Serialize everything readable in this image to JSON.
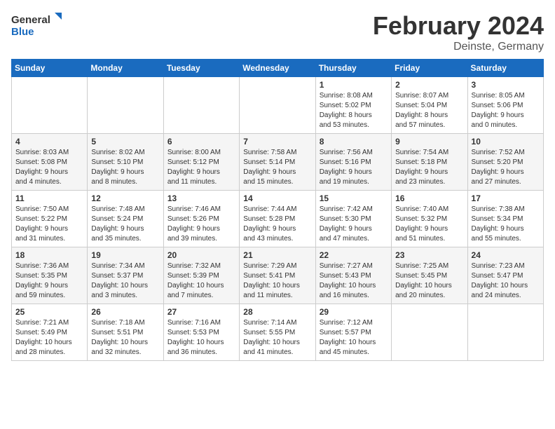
{
  "logo": {
    "general": "General",
    "blue": "Blue"
  },
  "title": "February 2024",
  "subtitle": "Deinste, Germany",
  "days_of_week": [
    "Sunday",
    "Monday",
    "Tuesday",
    "Wednesday",
    "Thursday",
    "Friday",
    "Saturday"
  ],
  "weeks": [
    [
      {
        "day": "",
        "info": ""
      },
      {
        "day": "",
        "info": ""
      },
      {
        "day": "",
        "info": ""
      },
      {
        "day": "",
        "info": ""
      },
      {
        "day": "1",
        "info": "Sunrise: 8:08 AM\nSunset: 5:02 PM\nDaylight: 8 hours\nand 53 minutes."
      },
      {
        "day": "2",
        "info": "Sunrise: 8:07 AM\nSunset: 5:04 PM\nDaylight: 8 hours\nand 57 minutes."
      },
      {
        "day": "3",
        "info": "Sunrise: 8:05 AM\nSunset: 5:06 PM\nDaylight: 9 hours\nand 0 minutes."
      }
    ],
    [
      {
        "day": "4",
        "info": "Sunrise: 8:03 AM\nSunset: 5:08 PM\nDaylight: 9 hours\nand 4 minutes."
      },
      {
        "day": "5",
        "info": "Sunrise: 8:02 AM\nSunset: 5:10 PM\nDaylight: 9 hours\nand 8 minutes."
      },
      {
        "day": "6",
        "info": "Sunrise: 8:00 AM\nSunset: 5:12 PM\nDaylight: 9 hours\nand 11 minutes."
      },
      {
        "day": "7",
        "info": "Sunrise: 7:58 AM\nSunset: 5:14 PM\nDaylight: 9 hours\nand 15 minutes."
      },
      {
        "day": "8",
        "info": "Sunrise: 7:56 AM\nSunset: 5:16 PM\nDaylight: 9 hours\nand 19 minutes."
      },
      {
        "day": "9",
        "info": "Sunrise: 7:54 AM\nSunset: 5:18 PM\nDaylight: 9 hours\nand 23 minutes."
      },
      {
        "day": "10",
        "info": "Sunrise: 7:52 AM\nSunset: 5:20 PM\nDaylight: 9 hours\nand 27 minutes."
      }
    ],
    [
      {
        "day": "11",
        "info": "Sunrise: 7:50 AM\nSunset: 5:22 PM\nDaylight: 9 hours\nand 31 minutes."
      },
      {
        "day": "12",
        "info": "Sunrise: 7:48 AM\nSunset: 5:24 PM\nDaylight: 9 hours\nand 35 minutes."
      },
      {
        "day": "13",
        "info": "Sunrise: 7:46 AM\nSunset: 5:26 PM\nDaylight: 9 hours\nand 39 minutes."
      },
      {
        "day": "14",
        "info": "Sunrise: 7:44 AM\nSunset: 5:28 PM\nDaylight: 9 hours\nand 43 minutes."
      },
      {
        "day": "15",
        "info": "Sunrise: 7:42 AM\nSunset: 5:30 PM\nDaylight: 9 hours\nand 47 minutes."
      },
      {
        "day": "16",
        "info": "Sunrise: 7:40 AM\nSunset: 5:32 PM\nDaylight: 9 hours\nand 51 minutes."
      },
      {
        "day": "17",
        "info": "Sunrise: 7:38 AM\nSunset: 5:34 PM\nDaylight: 9 hours\nand 55 minutes."
      }
    ],
    [
      {
        "day": "18",
        "info": "Sunrise: 7:36 AM\nSunset: 5:35 PM\nDaylight: 9 hours\nand 59 minutes."
      },
      {
        "day": "19",
        "info": "Sunrise: 7:34 AM\nSunset: 5:37 PM\nDaylight: 10 hours\nand 3 minutes."
      },
      {
        "day": "20",
        "info": "Sunrise: 7:32 AM\nSunset: 5:39 PM\nDaylight: 10 hours\nand 7 minutes."
      },
      {
        "day": "21",
        "info": "Sunrise: 7:29 AM\nSunset: 5:41 PM\nDaylight: 10 hours\nand 11 minutes."
      },
      {
        "day": "22",
        "info": "Sunrise: 7:27 AM\nSunset: 5:43 PM\nDaylight: 10 hours\nand 16 minutes."
      },
      {
        "day": "23",
        "info": "Sunrise: 7:25 AM\nSunset: 5:45 PM\nDaylight: 10 hours\nand 20 minutes."
      },
      {
        "day": "24",
        "info": "Sunrise: 7:23 AM\nSunset: 5:47 PM\nDaylight: 10 hours\nand 24 minutes."
      }
    ],
    [
      {
        "day": "25",
        "info": "Sunrise: 7:21 AM\nSunset: 5:49 PM\nDaylight: 10 hours\nand 28 minutes."
      },
      {
        "day": "26",
        "info": "Sunrise: 7:18 AM\nSunset: 5:51 PM\nDaylight: 10 hours\nand 32 minutes."
      },
      {
        "day": "27",
        "info": "Sunrise: 7:16 AM\nSunset: 5:53 PM\nDaylight: 10 hours\nand 36 minutes."
      },
      {
        "day": "28",
        "info": "Sunrise: 7:14 AM\nSunset: 5:55 PM\nDaylight: 10 hours\nand 41 minutes."
      },
      {
        "day": "29",
        "info": "Sunrise: 7:12 AM\nSunset: 5:57 PM\nDaylight: 10 hours\nand 45 minutes."
      },
      {
        "day": "",
        "info": ""
      },
      {
        "day": "",
        "info": ""
      }
    ]
  ]
}
